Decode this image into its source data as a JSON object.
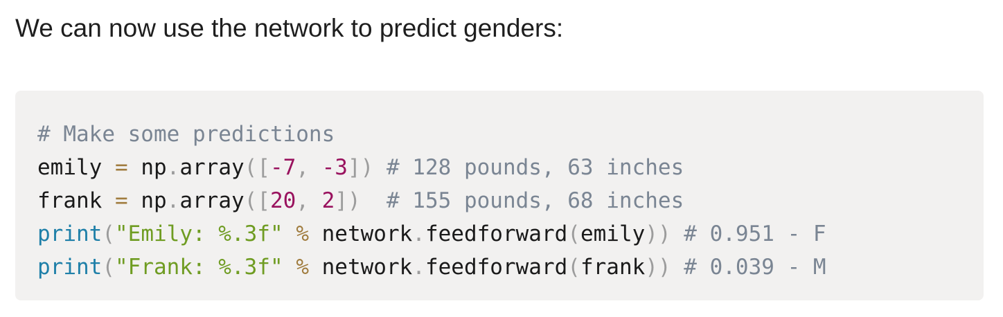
{
  "intro_text": "We can now use the network to predict genders:",
  "colors": {
    "comment": "#7a8593",
    "operator": "#a07c3e",
    "punctuation": "#9c9c9c",
    "number": "#99125e",
    "builtin": "#1e7fa8",
    "string": "#6f9c22",
    "text": "#1a1a1a",
    "code_background": "#f2f1f0"
  },
  "code_lines": [
    [
      {
        "t": "# Make some predictions",
        "k": "comment"
      }
    ],
    [
      {
        "t": "emily ",
        "k": "plain"
      },
      {
        "t": "=",
        "k": "op"
      },
      {
        "t": " np",
        "k": "plain"
      },
      {
        "t": ".",
        "k": "punc"
      },
      {
        "t": "array",
        "k": "plain"
      },
      {
        "t": "([",
        "k": "punc"
      },
      {
        "t": "-7",
        "k": "num"
      },
      {
        "t": ", ",
        "k": "punc"
      },
      {
        "t": "-3",
        "k": "num"
      },
      {
        "t": "])",
        "k": "punc"
      },
      {
        "t": " ",
        "k": "plain"
      },
      {
        "t": "# 128 pounds, 63 inches",
        "k": "comment"
      }
    ],
    [
      {
        "t": "frank ",
        "k": "plain"
      },
      {
        "t": "=",
        "k": "op"
      },
      {
        "t": " np",
        "k": "plain"
      },
      {
        "t": ".",
        "k": "punc"
      },
      {
        "t": "array",
        "k": "plain"
      },
      {
        "t": "([",
        "k": "punc"
      },
      {
        "t": "20",
        "k": "num"
      },
      {
        "t": ", ",
        "k": "punc"
      },
      {
        "t": "2",
        "k": "num"
      },
      {
        "t": "])",
        "k": "punc"
      },
      {
        "t": "  ",
        "k": "plain"
      },
      {
        "t": "# 155 pounds, 68 inches",
        "k": "comment"
      }
    ],
    [
      {
        "t": "print",
        "k": "builtin"
      },
      {
        "t": "(",
        "k": "punc"
      },
      {
        "t": "\"Emily: %.3f\"",
        "k": "str"
      },
      {
        "t": " ",
        "k": "plain"
      },
      {
        "t": "%",
        "k": "op"
      },
      {
        "t": " network",
        "k": "plain"
      },
      {
        "t": ".",
        "k": "punc"
      },
      {
        "t": "feedforward",
        "k": "plain"
      },
      {
        "t": "(",
        "k": "punc"
      },
      {
        "t": "emily",
        "k": "plain"
      },
      {
        "t": "))",
        "k": "punc"
      },
      {
        "t": " ",
        "k": "plain"
      },
      {
        "t": "# 0.951 - F",
        "k": "comment"
      }
    ],
    [
      {
        "t": "print",
        "k": "builtin"
      },
      {
        "t": "(",
        "k": "punc"
      },
      {
        "t": "\"Frank: %.3f\"",
        "k": "str"
      },
      {
        "t": " ",
        "k": "plain"
      },
      {
        "t": "%",
        "k": "op"
      },
      {
        "t": " network",
        "k": "plain"
      },
      {
        "t": ".",
        "k": "punc"
      },
      {
        "t": "feedforward",
        "k": "plain"
      },
      {
        "t": "(",
        "k": "punc"
      },
      {
        "t": "frank",
        "k": "plain"
      },
      {
        "t": "))",
        "k": "punc"
      },
      {
        "t": " ",
        "k": "plain"
      },
      {
        "t": "# 0.039 - M",
        "k": "comment"
      }
    ]
  ]
}
